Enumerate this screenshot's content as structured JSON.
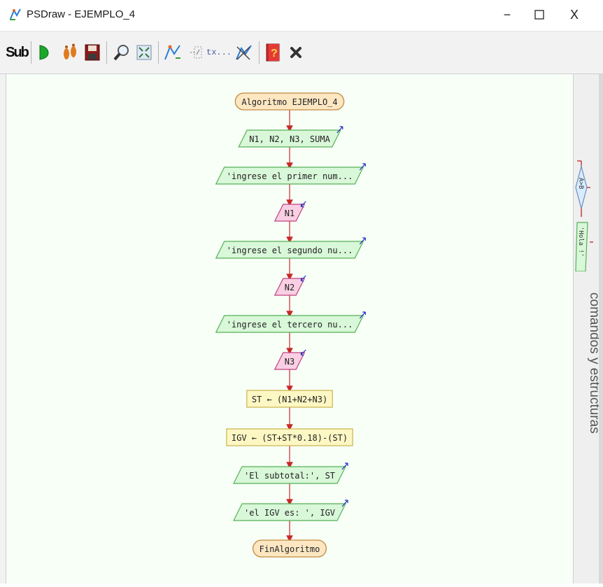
{
  "window": {
    "title": "PSDraw - EJEMPLO_4",
    "controls": {
      "minimize": "−",
      "maximize": "☐",
      "close": "X"
    }
  },
  "toolbar": {
    "sub_label": "Sub",
    "tx_label": "tx...",
    "buttons": [
      "sub-icon",
      "run-icon",
      "steps-icon",
      "save-icon",
      "zoom-icon",
      "fit-icon",
      "edit-icon",
      "comment-icon",
      "text-icon",
      "draw-icon",
      "help-icon",
      "close-icon"
    ]
  },
  "flowchart": {
    "start": "Algoritmo EJEMPLO_4",
    "steps": [
      {
        "kind": "define",
        "text": "N1, N2, N3, SUMA"
      },
      {
        "kind": "write",
        "text": "'ingrese el primer num..."
      },
      {
        "kind": "read",
        "text": "N1"
      },
      {
        "kind": "write",
        "text": "'ingrese el segundo nu..."
      },
      {
        "kind": "read",
        "text": "N2"
      },
      {
        "kind": "write",
        "text": "'ingrese el tercero nu..."
      },
      {
        "kind": "read",
        "text": "N3"
      },
      {
        "kind": "assign",
        "text": "ST ← (N1+N2+N3)"
      },
      {
        "kind": "assign",
        "text": "IGV ← (ST+ST*0.18)-(ST)"
      },
      {
        "kind": "write",
        "text": "'El subtotal:', ST"
      },
      {
        "kind": "write",
        "text": "'el IGV es: ', IGV"
      }
    ],
    "end": "FinAlgoritmo"
  },
  "side_panel": {
    "label": "comandos y estructuras",
    "if_label": "A>B",
    "write_label": "'Hola !'"
  },
  "colors": {
    "canvas_bg": "#f7fff7",
    "terminal_fill": "#fde7c2",
    "terminal_stroke": "#c28a3c",
    "io_fill": "#d9f7d9",
    "io_stroke": "#56b156",
    "read_fill": "#f9cfe3",
    "read_stroke": "#c2407e",
    "assign_fill": "#fdf7c3",
    "assign_stroke": "#c9b34a",
    "arrow": "#c82828",
    "io_arrow": "#1a2fbf"
  }
}
